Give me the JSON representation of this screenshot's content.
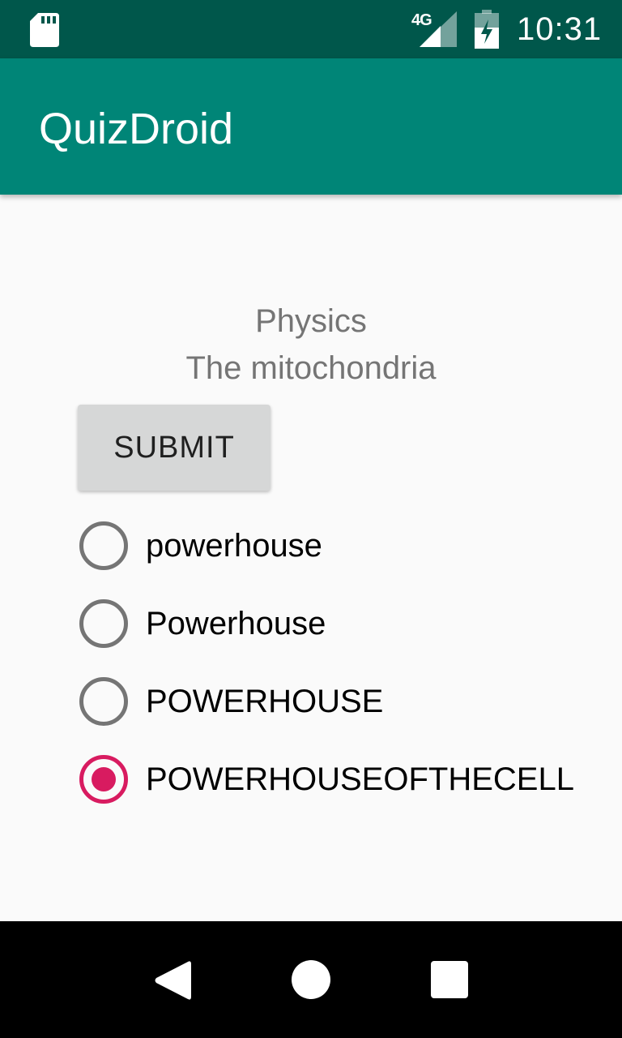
{
  "status_bar": {
    "network": "4G",
    "time": "10:31",
    "icons": [
      "sd-card-icon",
      "signal-icon",
      "battery-charging-icon"
    ]
  },
  "app_bar": {
    "title": "QuizDroid"
  },
  "quiz": {
    "category": "Physics",
    "question": "The mitochondria",
    "submit_label": "SUBMIT",
    "options": [
      {
        "label": "powerhouse",
        "checked": false
      },
      {
        "label": "Powerhouse",
        "checked": false
      },
      {
        "label": "POWERHOUSE",
        "checked": false
      },
      {
        "label": "POWERHOUSEOFTHECELL",
        "checked": true
      }
    ]
  },
  "nav_bar": {
    "icons": [
      "back-icon",
      "home-icon",
      "recents-icon"
    ]
  },
  "colors": {
    "status_bar": "#00574b",
    "primary": "#008577",
    "accent": "#d81b60",
    "radio_unchecked": "#757575"
  }
}
